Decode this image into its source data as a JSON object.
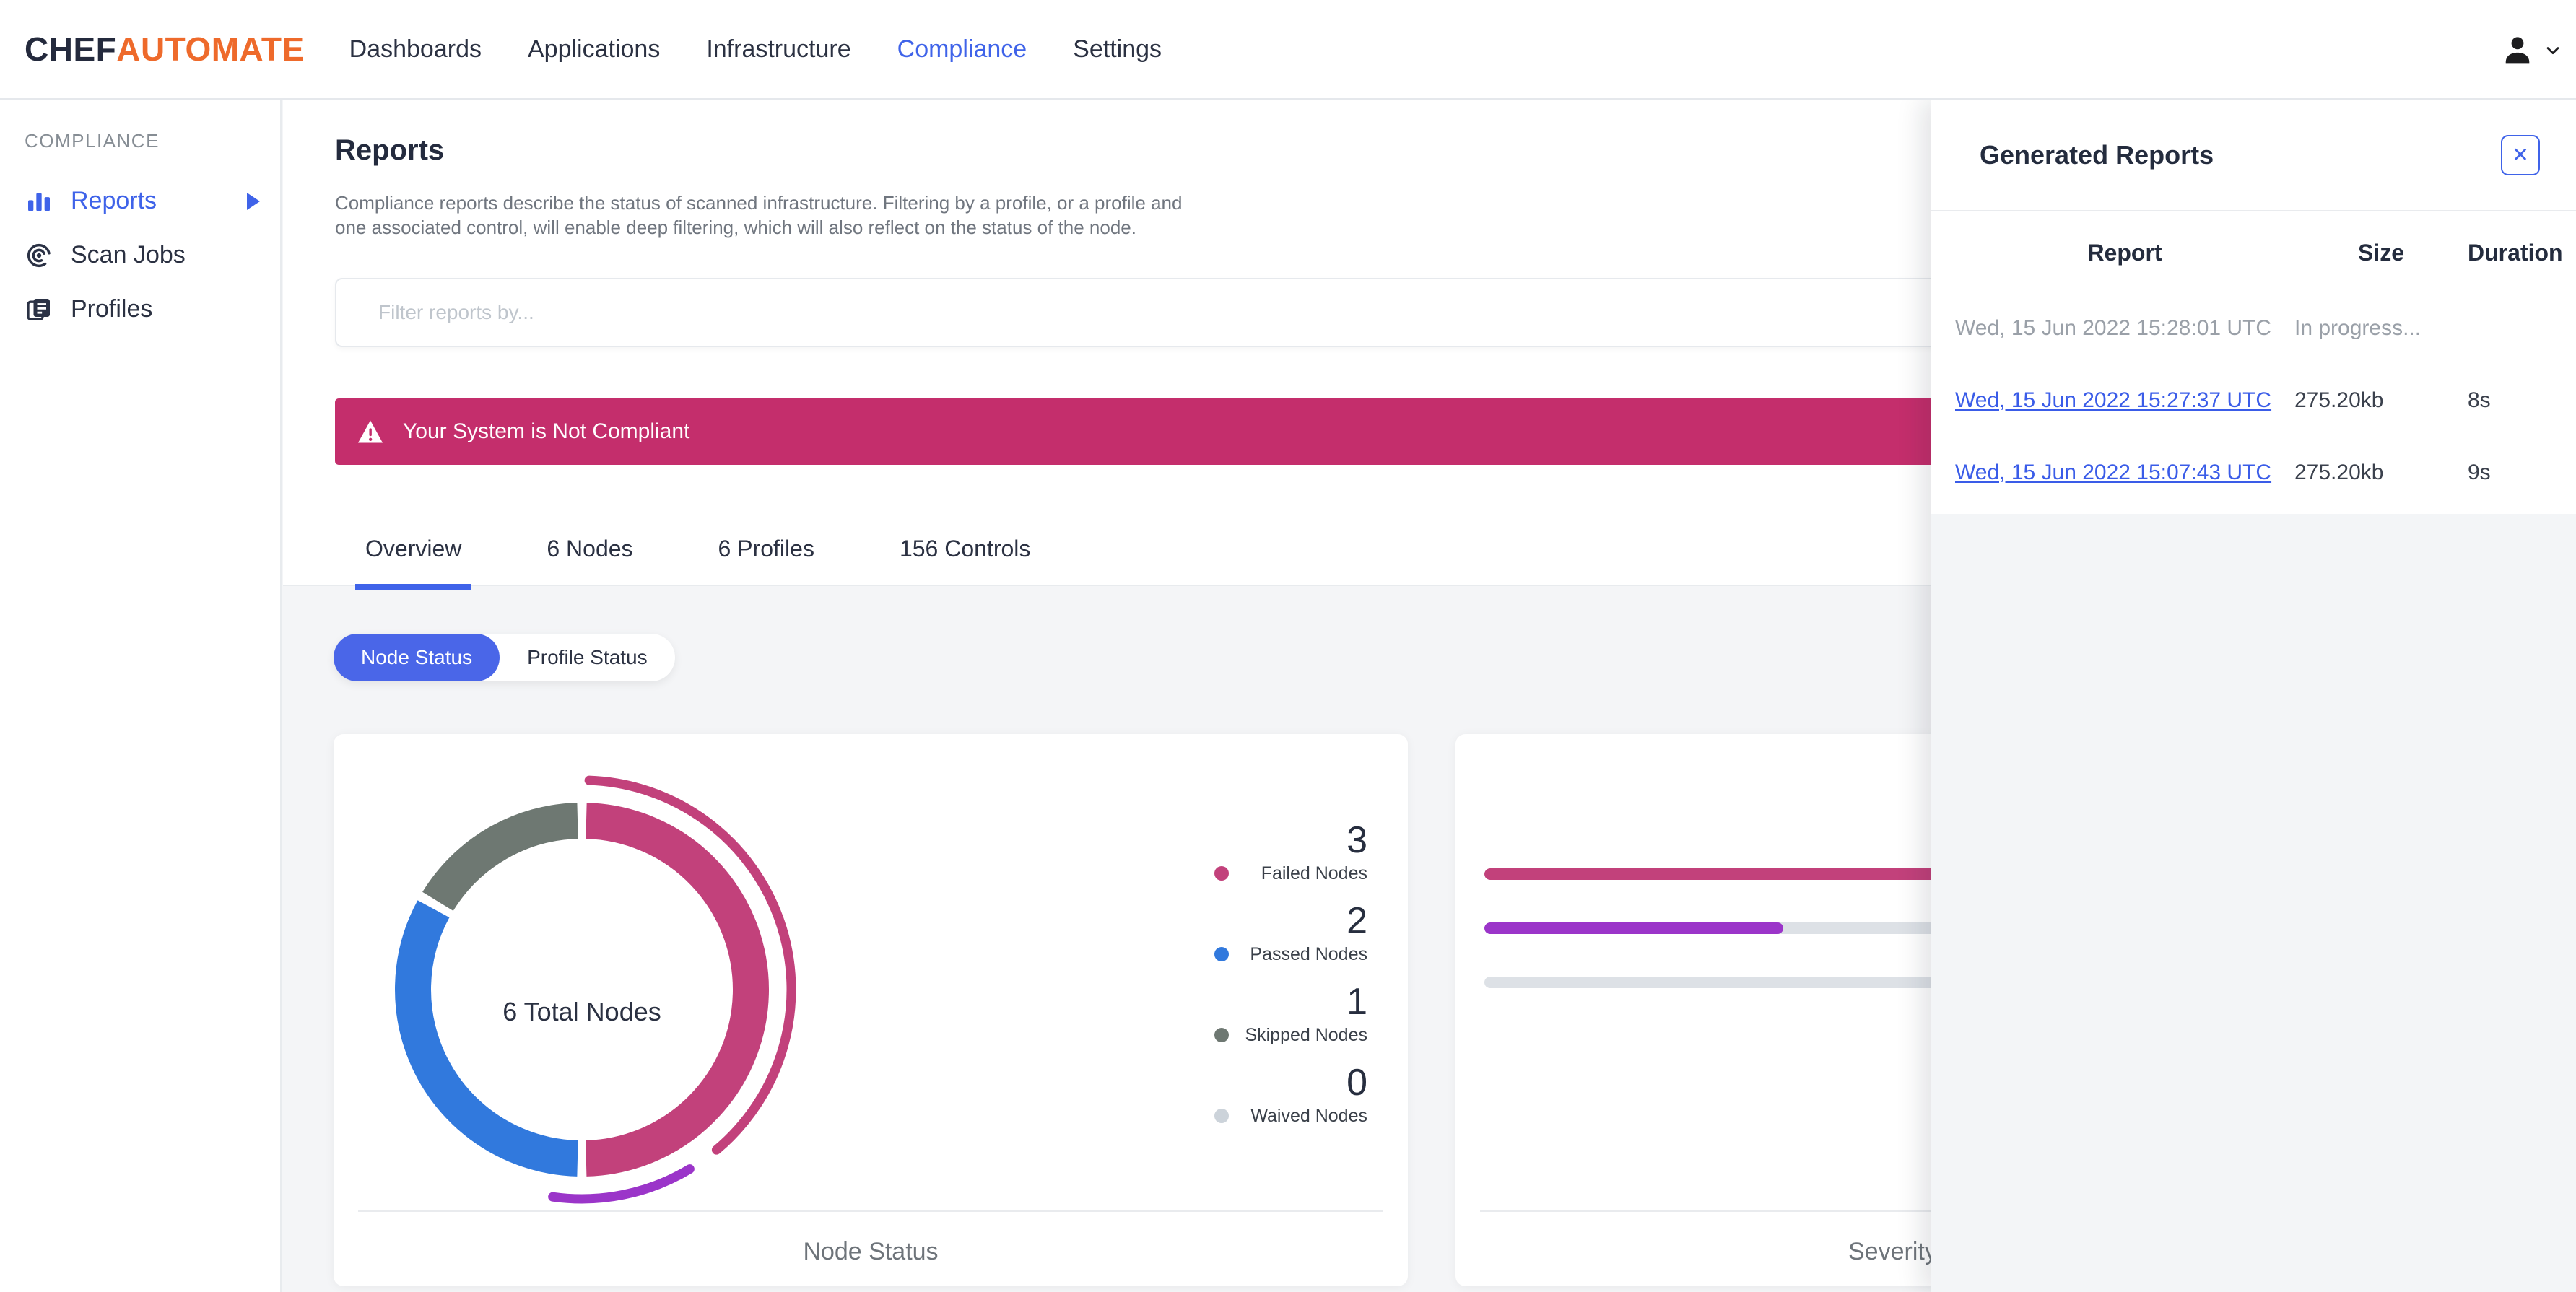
{
  "brand": {
    "name_bold": "CHEF",
    "name_light": "AUTOMATE"
  },
  "nav": {
    "items": [
      {
        "label": "Dashboards",
        "active": false
      },
      {
        "label": "Applications",
        "active": false
      },
      {
        "label": "Infrastructure",
        "active": false
      },
      {
        "label": "Compliance",
        "active": true
      },
      {
        "label": "Settings",
        "active": false
      }
    ]
  },
  "sidebar": {
    "section_label": "COMPLIANCE",
    "items": [
      {
        "label": "Reports",
        "active": true
      },
      {
        "label": "Scan Jobs",
        "active": false
      },
      {
        "label": "Profiles",
        "active": false
      }
    ]
  },
  "page": {
    "title": "Reports",
    "description_line1": "Compliance reports describe the status of scanned infrastructure. Filtering by a profile, or a profile and",
    "description_line2": "one associated control, will enable deep filtering, which will also reflect on the status of the node."
  },
  "filter": {
    "placeholder": "Filter reports by..."
  },
  "alert": {
    "message": "Your System is Not Compliant",
    "color": "#c42e6c"
  },
  "tabs": [
    {
      "label": "Overview",
      "active": true
    },
    {
      "label": "6 Nodes",
      "active": false
    },
    {
      "label": "6 Profiles",
      "active": false
    },
    {
      "label": "156 Controls",
      "active": false
    }
  ],
  "status_toggle": [
    {
      "label": "Node Status",
      "active": true
    },
    {
      "label": "Profile Status",
      "active": false
    }
  ],
  "generated_reports": {
    "title": "Generated Reports",
    "close_icon": "✕",
    "columns": [
      "Report",
      "Size",
      "Duration"
    ],
    "rows": [
      {
        "report": "Wed, 15 Jun 2022 15:28:01 UTC",
        "size": "In progress...",
        "duration": "",
        "is_link": false
      },
      {
        "report": "Wed, 15 Jun 2022 15:27:37 UTC",
        "size": "275.20kb",
        "duration": "8s",
        "is_link": true
      },
      {
        "report": "Wed, 15 Jun 2022 15:07:43 UTC",
        "size": "275.20kb",
        "duration": "9s",
        "is_link": true
      }
    ]
  },
  "chart_data": [
    {
      "type": "pie",
      "subtype": "donut",
      "title": "Node Status",
      "center_label": "6 Total Nodes",
      "total": 6,
      "segments": [
        {
          "label": "Failed Nodes",
          "value": 3,
          "color": "#c2417b"
        },
        {
          "label": "Passed Nodes",
          "value": 2,
          "color": "#3179dd"
        },
        {
          "label": "Skipped Nodes",
          "value": 1,
          "color": "#6e7872"
        },
        {
          "label": "Waived Nodes",
          "value": 0,
          "color": "#ccd3da"
        }
      ],
      "outer_arcs": [
        {
          "color": "#c2417b",
          "start_deg": 2,
          "end_deg": 140
        },
        {
          "color": "#9b35c9",
          "start_deg": 149,
          "end_deg": 188
        }
      ],
      "legend_position": "right"
    },
    {
      "type": "bar",
      "orientation": "horizontal",
      "title": "Severity",
      "track_color": "#dde1e6",
      "bars": [
        {
          "color": "#c2417b",
          "fraction": 1
        },
        {
          "color": "#9b35c9",
          "fraction": 0.33
        },
        {
          "color": "#dde1e6",
          "fraction": 0
        }
      ],
      "bar_y": [
        186,
        261,
        336
      ]
    }
  ],
  "colors": {
    "accent": "#3f63e9",
    "link": "#3a5ce8",
    "banner": "#c42e6c",
    "page_bg": "#f4f5f7",
    "text_dark": "#262c40",
    "text_gray": "#70767f"
  }
}
